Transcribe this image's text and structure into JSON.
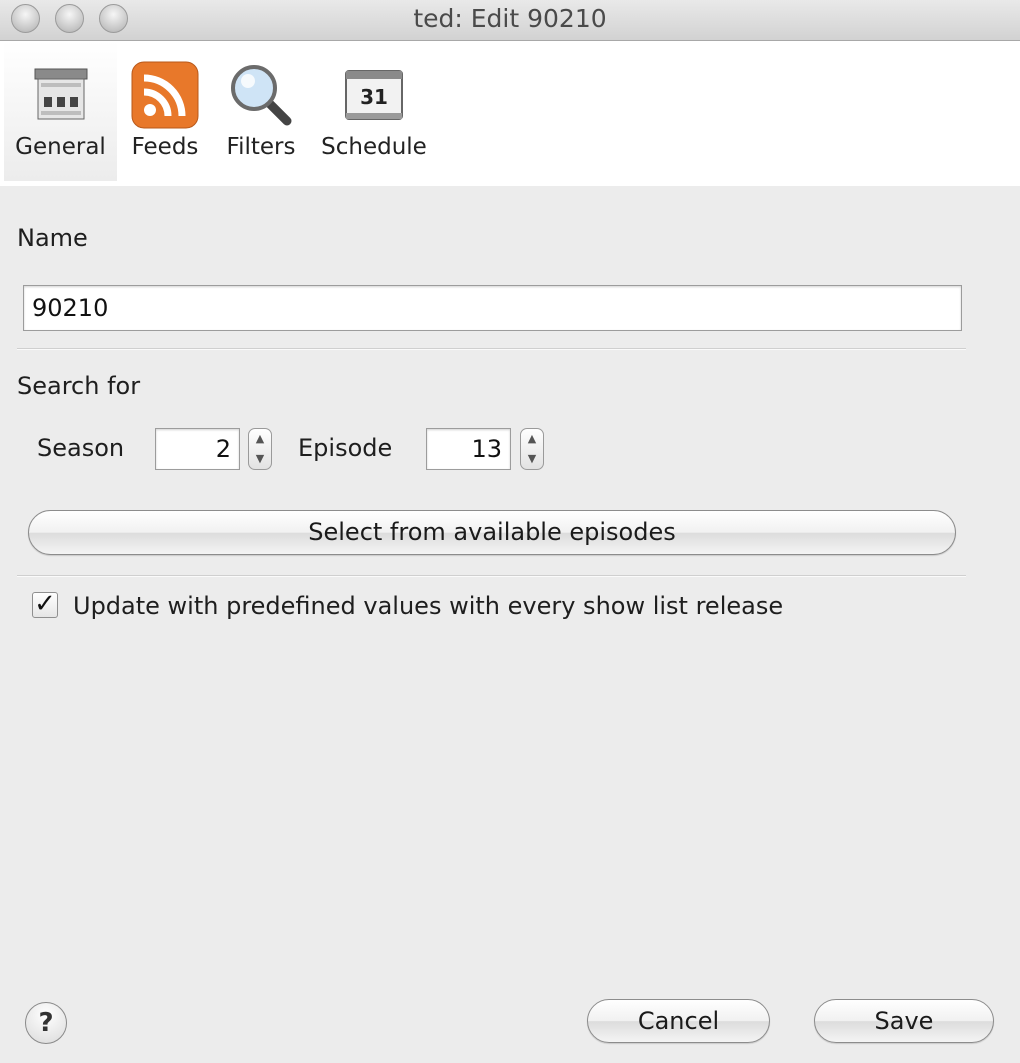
{
  "window": {
    "title": "ted: Edit 90210"
  },
  "toolbar": {
    "tabs": [
      {
        "label": "General",
        "icon": "general-icon",
        "selected": true
      },
      {
        "label": "Feeds",
        "icon": "rss-feed-icon",
        "selected": false
      },
      {
        "label": "Filters",
        "icon": "magnifier-icon",
        "selected": false
      },
      {
        "label": "Schedule",
        "icon": "calendar-icon",
        "selected": false,
        "calendar_day": "31"
      }
    ]
  },
  "general": {
    "name_label": "Name",
    "name_value": "90210",
    "search_for_label": "Search for",
    "season_label": "Season",
    "season_value": "2",
    "episode_label": "Episode",
    "episode_value": "13",
    "select_button_label": "Select from available episodes",
    "update_checkbox_label": "Update with predefined values with every show list release",
    "update_checkbox_checked": true
  },
  "footer": {
    "help_label": "?",
    "cancel_label": "Cancel",
    "save_label": "Save"
  },
  "colors": {
    "window_background": "#ececec",
    "rss_orange": "#e8782a"
  }
}
